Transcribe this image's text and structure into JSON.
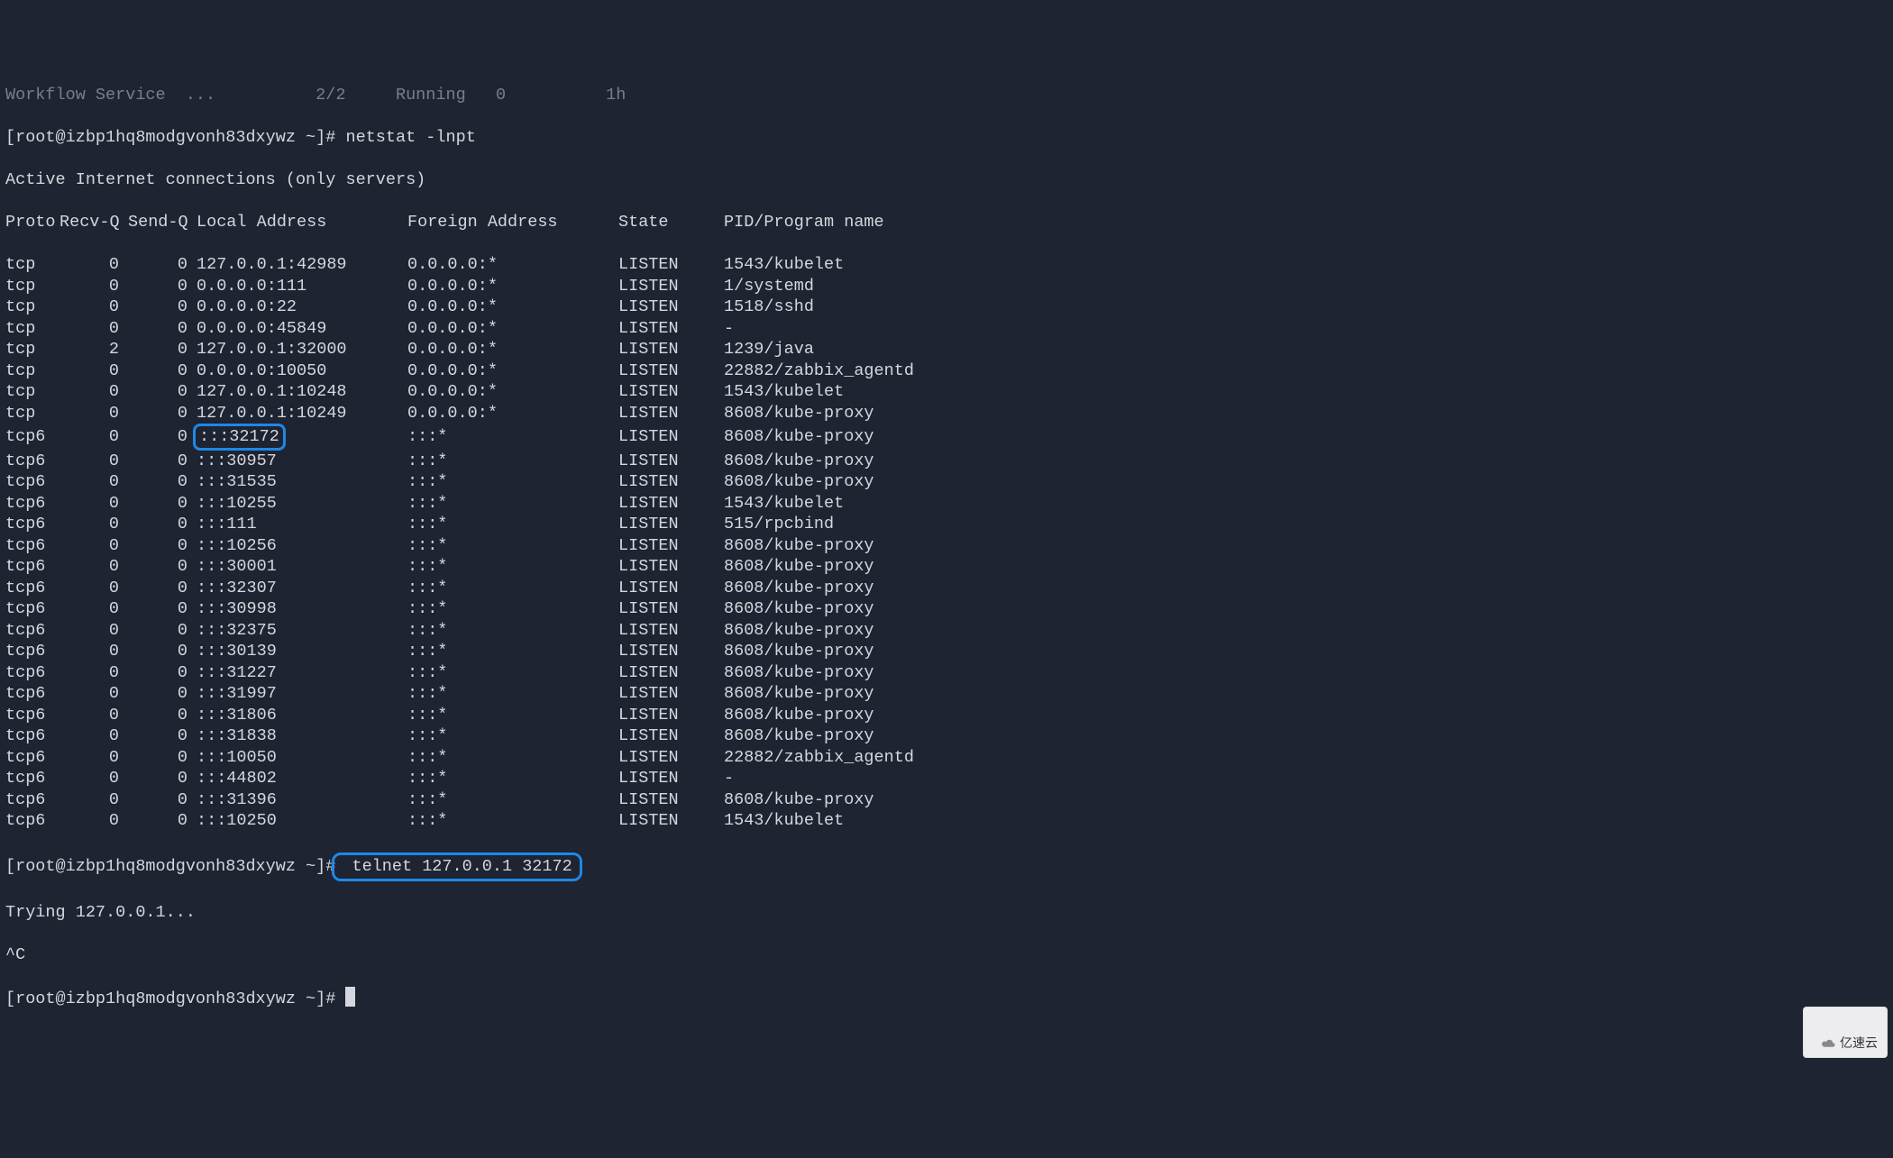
{
  "truncated_top": "Workflow Service  ...          2/2     Running   0          1h",
  "prompt1": "[root@izbp1hq8modgvonh83dxywz ~]# ",
  "cmd1": "netstat -lnpt",
  "heading": "Active Internet connections (only servers)",
  "hdr": {
    "proto": "Proto",
    "recvq": "Recv-Q",
    "sendq": "Send-Q",
    "local": "Local Address",
    "foreign": "Foreign Address",
    "state": "State",
    "pidprog": "PID/Program name"
  },
  "rows": [
    {
      "proto": "tcp",
      "recvq": "0",
      "sendq": "0",
      "local": "127.0.0.1:42989",
      "foreign": "0.0.0.0:*",
      "state": "LISTEN",
      "pidprog": "1543/kubelet"
    },
    {
      "proto": "tcp",
      "recvq": "0",
      "sendq": "0",
      "local": "0.0.0.0:111",
      "foreign": "0.0.0.0:*",
      "state": "LISTEN",
      "pidprog": "1/systemd"
    },
    {
      "proto": "tcp",
      "recvq": "0",
      "sendq": "0",
      "local": "0.0.0.0:22",
      "foreign": "0.0.0.0:*",
      "state": "LISTEN",
      "pidprog": "1518/sshd"
    },
    {
      "proto": "tcp",
      "recvq": "0",
      "sendq": "0",
      "local": "0.0.0.0:45849",
      "foreign": "0.0.0.0:*",
      "state": "LISTEN",
      "pidprog": "-"
    },
    {
      "proto": "tcp",
      "recvq": "2",
      "sendq": "0",
      "local": "127.0.0.1:32000",
      "foreign": "0.0.0.0:*",
      "state": "LISTEN",
      "pidprog": "1239/java"
    },
    {
      "proto": "tcp",
      "recvq": "0",
      "sendq": "0",
      "local": "0.0.0.0:10050",
      "foreign": "0.0.0.0:*",
      "state": "LISTEN",
      "pidprog": "22882/zabbix_agentd"
    },
    {
      "proto": "tcp",
      "recvq": "0",
      "sendq": "0",
      "local": "127.0.0.1:10248",
      "foreign": "0.0.0.0:*",
      "state": "LISTEN",
      "pidprog": "1543/kubelet"
    },
    {
      "proto": "tcp",
      "recvq": "0",
      "sendq": "0",
      "local": "127.0.0.1:10249",
      "foreign": "0.0.0.0:*",
      "state": "LISTEN",
      "pidprog": "8608/kube-proxy"
    },
    {
      "proto": "tcp6",
      "recvq": "0",
      "sendq": "0",
      "local": ":::32172",
      "foreign": ":::*",
      "state": "LISTEN",
      "pidprog": "8608/kube-proxy",
      "hl": true
    },
    {
      "proto": "tcp6",
      "recvq": "0",
      "sendq": "0",
      "local": ":::30957",
      "foreign": ":::*",
      "state": "LISTEN",
      "pidprog": "8608/kube-proxy"
    },
    {
      "proto": "tcp6",
      "recvq": "0",
      "sendq": "0",
      "local": ":::31535",
      "foreign": ":::*",
      "state": "LISTEN",
      "pidprog": "8608/kube-proxy"
    },
    {
      "proto": "tcp6",
      "recvq": "0",
      "sendq": "0",
      "local": ":::10255",
      "foreign": ":::*",
      "state": "LISTEN",
      "pidprog": "1543/kubelet"
    },
    {
      "proto": "tcp6",
      "recvq": "0",
      "sendq": "0",
      "local": ":::111",
      "foreign": ":::*",
      "state": "LISTEN",
      "pidprog": "515/rpcbind"
    },
    {
      "proto": "tcp6",
      "recvq": "0",
      "sendq": "0",
      "local": ":::10256",
      "foreign": ":::*",
      "state": "LISTEN",
      "pidprog": "8608/kube-proxy"
    },
    {
      "proto": "tcp6",
      "recvq": "0",
      "sendq": "0",
      "local": ":::30001",
      "foreign": ":::*",
      "state": "LISTEN",
      "pidprog": "8608/kube-proxy"
    },
    {
      "proto": "tcp6",
      "recvq": "0",
      "sendq": "0",
      "local": ":::32307",
      "foreign": ":::*",
      "state": "LISTEN",
      "pidprog": "8608/kube-proxy"
    },
    {
      "proto": "tcp6",
      "recvq": "0",
      "sendq": "0",
      "local": ":::30998",
      "foreign": ":::*",
      "state": "LISTEN",
      "pidprog": "8608/kube-proxy"
    },
    {
      "proto": "tcp6",
      "recvq": "0",
      "sendq": "0",
      "local": ":::32375",
      "foreign": ":::*",
      "state": "LISTEN",
      "pidprog": "8608/kube-proxy"
    },
    {
      "proto": "tcp6",
      "recvq": "0",
      "sendq": "0",
      "local": ":::30139",
      "foreign": ":::*",
      "state": "LISTEN",
      "pidprog": "8608/kube-proxy"
    },
    {
      "proto": "tcp6",
      "recvq": "0",
      "sendq": "0",
      "local": ":::31227",
      "foreign": ":::*",
      "state": "LISTEN",
      "pidprog": "8608/kube-proxy"
    },
    {
      "proto": "tcp6",
      "recvq": "0",
      "sendq": "0",
      "local": ":::31997",
      "foreign": ":::*",
      "state": "LISTEN",
      "pidprog": "8608/kube-proxy"
    },
    {
      "proto": "tcp6",
      "recvq": "0",
      "sendq": "0",
      "local": ":::31806",
      "foreign": ":::*",
      "state": "LISTEN",
      "pidprog": "8608/kube-proxy"
    },
    {
      "proto": "tcp6",
      "recvq": "0",
      "sendq": "0",
      "local": ":::31838",
      "foreign": ":::*",
      "state": "LISTEN",
      "pidprog": "8608/kube-proxy"
    },
    {
      "proto": "tcp6",
      "recvq": "0",
      "sendq": "0",
      "local": ":::10050",
      "foreign": ":::*",
      "state": "LISTEN",
      "pidprog": "22882/zabbix_agentd"
    },
    {
      "proto": "tcp6",
      "recvq": "0",
      "sendq": "0",
      "local": ":::44802",
      "foreign": ":::*",
      "state": "LISTEN",
      "pidprog": "-"
    },
    {
      "proto": "tcp6",
      "recvq": "0",
      "sendq": "0",
      "local": ":::31396",
      "foreign": ":::*",
      "state": "LISTEN",
      "pidprog": "8608/kube-proxy"
    },
    {
      "proto": "tcp6",
      "recvq": "0",
      "sendq": "0",
      "local": ":::10250",
      "foreign": ":::*",
      "state": "LISTEN",
      "pidprog": "1543/kubelet"
    }
  ],
  "prompt2": "[root@izbp1hq8modgvonh83dxywz ~]#",
  "cmd2": " telnet 127.0.0.1 32172",
  "trying": "Trying 127.0.0.1...",
  "interrupt": "^C",
  "prompt3": "[root@izbp1hq8modgvonh83dxywz ~]# ",
  "watermark": "亿速云"
}
